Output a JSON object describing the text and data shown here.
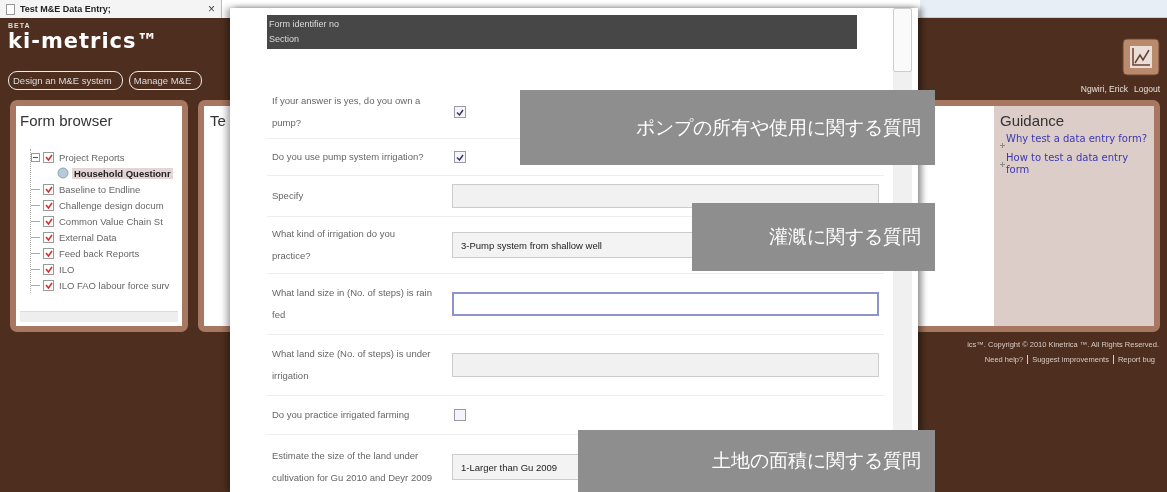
{
  "tab": {
    "title": "Test M&E Data Entry;",
    "close": "×"
  },
  "brand": {
    "badge": "BETA",
    "name": "ki-metrics™"
  },
  "nav": [
    "Design an M&E system",
    "Manage M&E"
  ],
  "user": {
    "name": "Ngwiri, Erick",
    "logout": "Logout"
  },
  "form_browser": {
    "title": "Form browser",
    "tree": [
      {
        "label": "Project Reports",
        "kind": "folder",
        "checked": true,
        "expanded": true,
        "selected": false,
        "children": [
          {
            "label": "Household Questionr",
            "kind": "form",
            "selected": true
          }
        ]
      },
      {
        "label": "Baseline to Endline",
        "kind": "folder",
        "checked": true,
        "selected": false
      },
      {
        "label": "Challenge design docum",
        "kind": "folder",
        "checked": true,
        "selected": false
      },
      {
        "label": "Common Value Chain St",
        "kind": "folder",
        "checked": true,
        "selected": false
      },
      {
        "label": "External Data",
        "kind": "folder",
        "checked": true,
        "selected": false
      },
      {
        "label": "Feed back Reports",
        "kind": "folder",
        "checked": true,
        "selected": false
      },
      {
        "label": "ILO",
        "kind": "folder",
        "checked": true,
        "selected": false
      },
      {
        "label": "ILO FAO labour force surv",
        "kind": "folder",
        "checked": true,
        "selected": false
      }
    ]
  },
  "panel_2": {
    "title": "Te"
  },
  "guidance": {
    "title": "Guidance",
    "links": [
      "Why test a data entry form?",
      "How to test a data entry form"
    ]
  },
  "footer": {
    "copyright": "ics™.  Copyright © 2010 Kinetrica ™.  All Rights Reserved.",
    "links": [
      "Need help?",
      "Suggest improvements",
      "Report bug"
    ]
  },
  "dialog": {
    "header": [
      "Form identifier no",
      "Section"
    ],
    "fields": [
      {
        "kind": "checkbox",
        "label": "If your answer is yes, do you own a pump?",
        "checked": true
      },
      {
        "kind": "checkbox",
        "label": "Do you use pump system irrigation?",
        "checked": true
      },
      {
        "kind": "text",
        "label": "Specify",
        "disabled": true,
        "focused": false
      },
      {
        "kind": "select",
        "label": "What kind of irrigation do you practice?",
        "value": "3-Pump system from shallow well"
      },
      {
        "kind": "text",
        "label": "What land size in (No. of steps) is rain fed",
        "disabled": false,
        "focused": true
      },
      {
        "kind": "text",
        "label": "What land size (No. of steps) is under irrigation",
        "disabled": true,
        "focused": false
      },
      {
        "kind": "checkbox",
        "label": "Do you practice irrigated farming",
        "checked": false
      },
      {
        "kind": "select",
        "label": "Estimate the size of the land under cultivation for Gu 2010 and Deyr 2009",
        "value": "1-Larger than Gu 2009"
      }
    ]
  },
  "captions": [
    "ポンプの所有や使用に関する質問",
    "灌漑に関する質問",
    "土地の面積に関する質問"
  ]
}
